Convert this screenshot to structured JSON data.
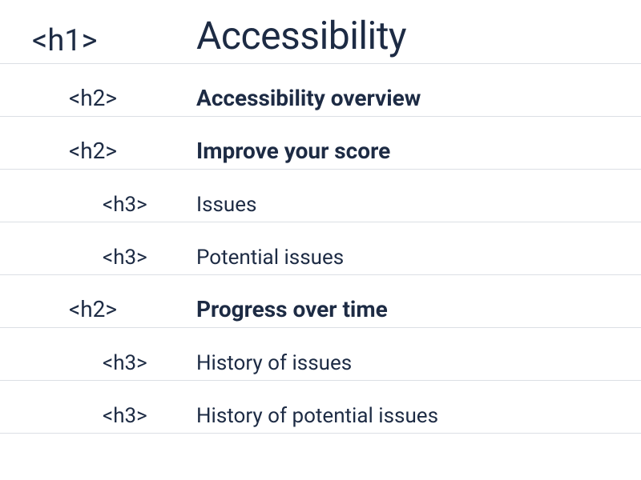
{
  "headings": [
    {
      "level": 1,
      "tag": "<h1>",
      "text": "Accessibility"
    },
    {
      "level": 2,
      "tag": "<h2>",
      "text": "Accessibility overview"
    },
    {
      "level": 2,
      "tag": "<h2>",
      "text": "Improve your score"
    },
    {
      "level": 3,
      "tag": "<h3>",
      "text": "Issues"
    },
    {
      "level": 3,
      "tag": "<h3>",
      "text": "Potential issues"
    },
    {
      "level": 2,
      "tag": "<h2>",
      "text": "Progress over time"
    },
    {
      "level": 3,
      "tag": "<h3>",
      "text": "History of issues"
    },
    {
      "level": 3,
      "tag": "<h3>",
      "text": "History of potential issues"
    }
  ]
}
